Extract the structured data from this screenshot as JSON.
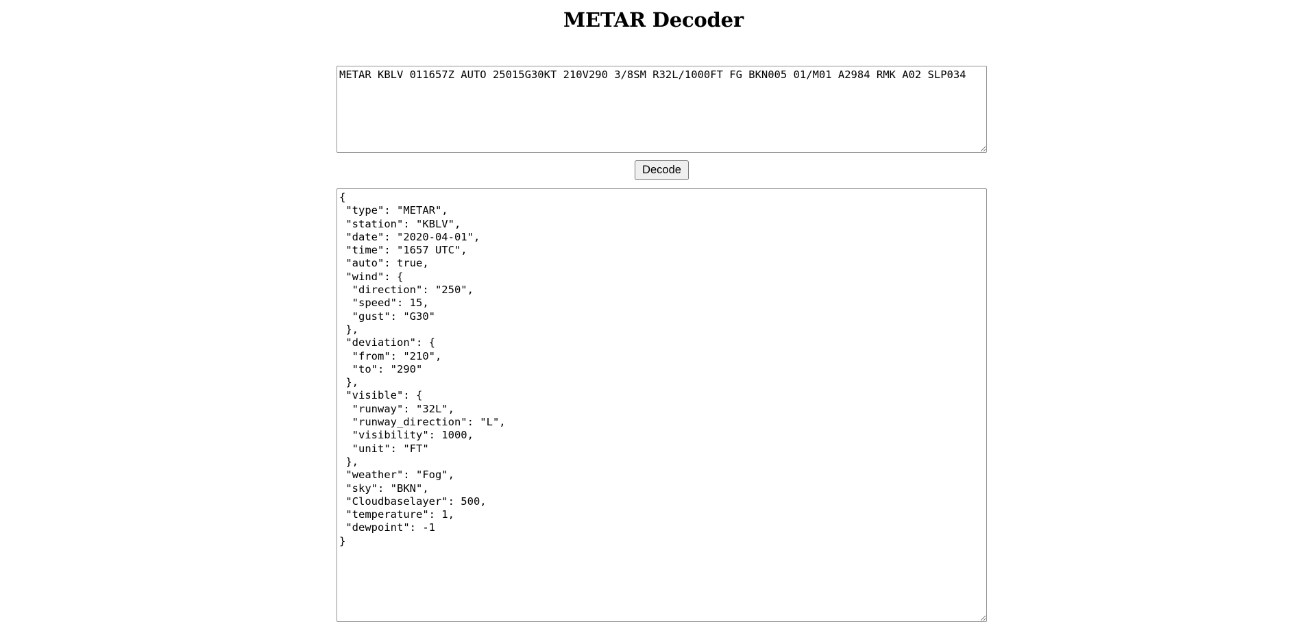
{
  "page": {
    "title": "METAR Decoder"
  },
  "input": {
    "value": "METAR KBLV 011657Z AUTO 25015G30KT 210V290 3/8SM R32L/1000FT FG BKN005 01/M01 A2984 RMK A02 SLP034"
  },
  "decode_button": {
    "label": "Decode"
  },
  "output": {
    "value": "{\n \"type\": \"METAR\",\n \"station\": \"KBLV\",\n \"date\": \"2020-04-01\",\n \"time\": \"1657 UTC\",\n \"auto\": true,\n \"wind\": {\n  \"direction\": \"250\",\n  \"speed\": 15,\n  \"gust\": \"G30\"\n },\n \"deviation\": {\n  \"from\": \"210\",\n  \"to\": \"290\"\n },\n \"visible\": {\n  \"runway\": \"32L\",\n  \"runway_direction\": \"L\",\n  \"visibility\": 1000,\n  \"unit\": \"FT\"\n },\n \"weather\": \"Fog\",\n \"sky\": \"BKN\",\n \"Cloudbaselayer\": 500,\n \"temperature\": 1,\n \"dewpoint\": -1\n}"
  }
}
